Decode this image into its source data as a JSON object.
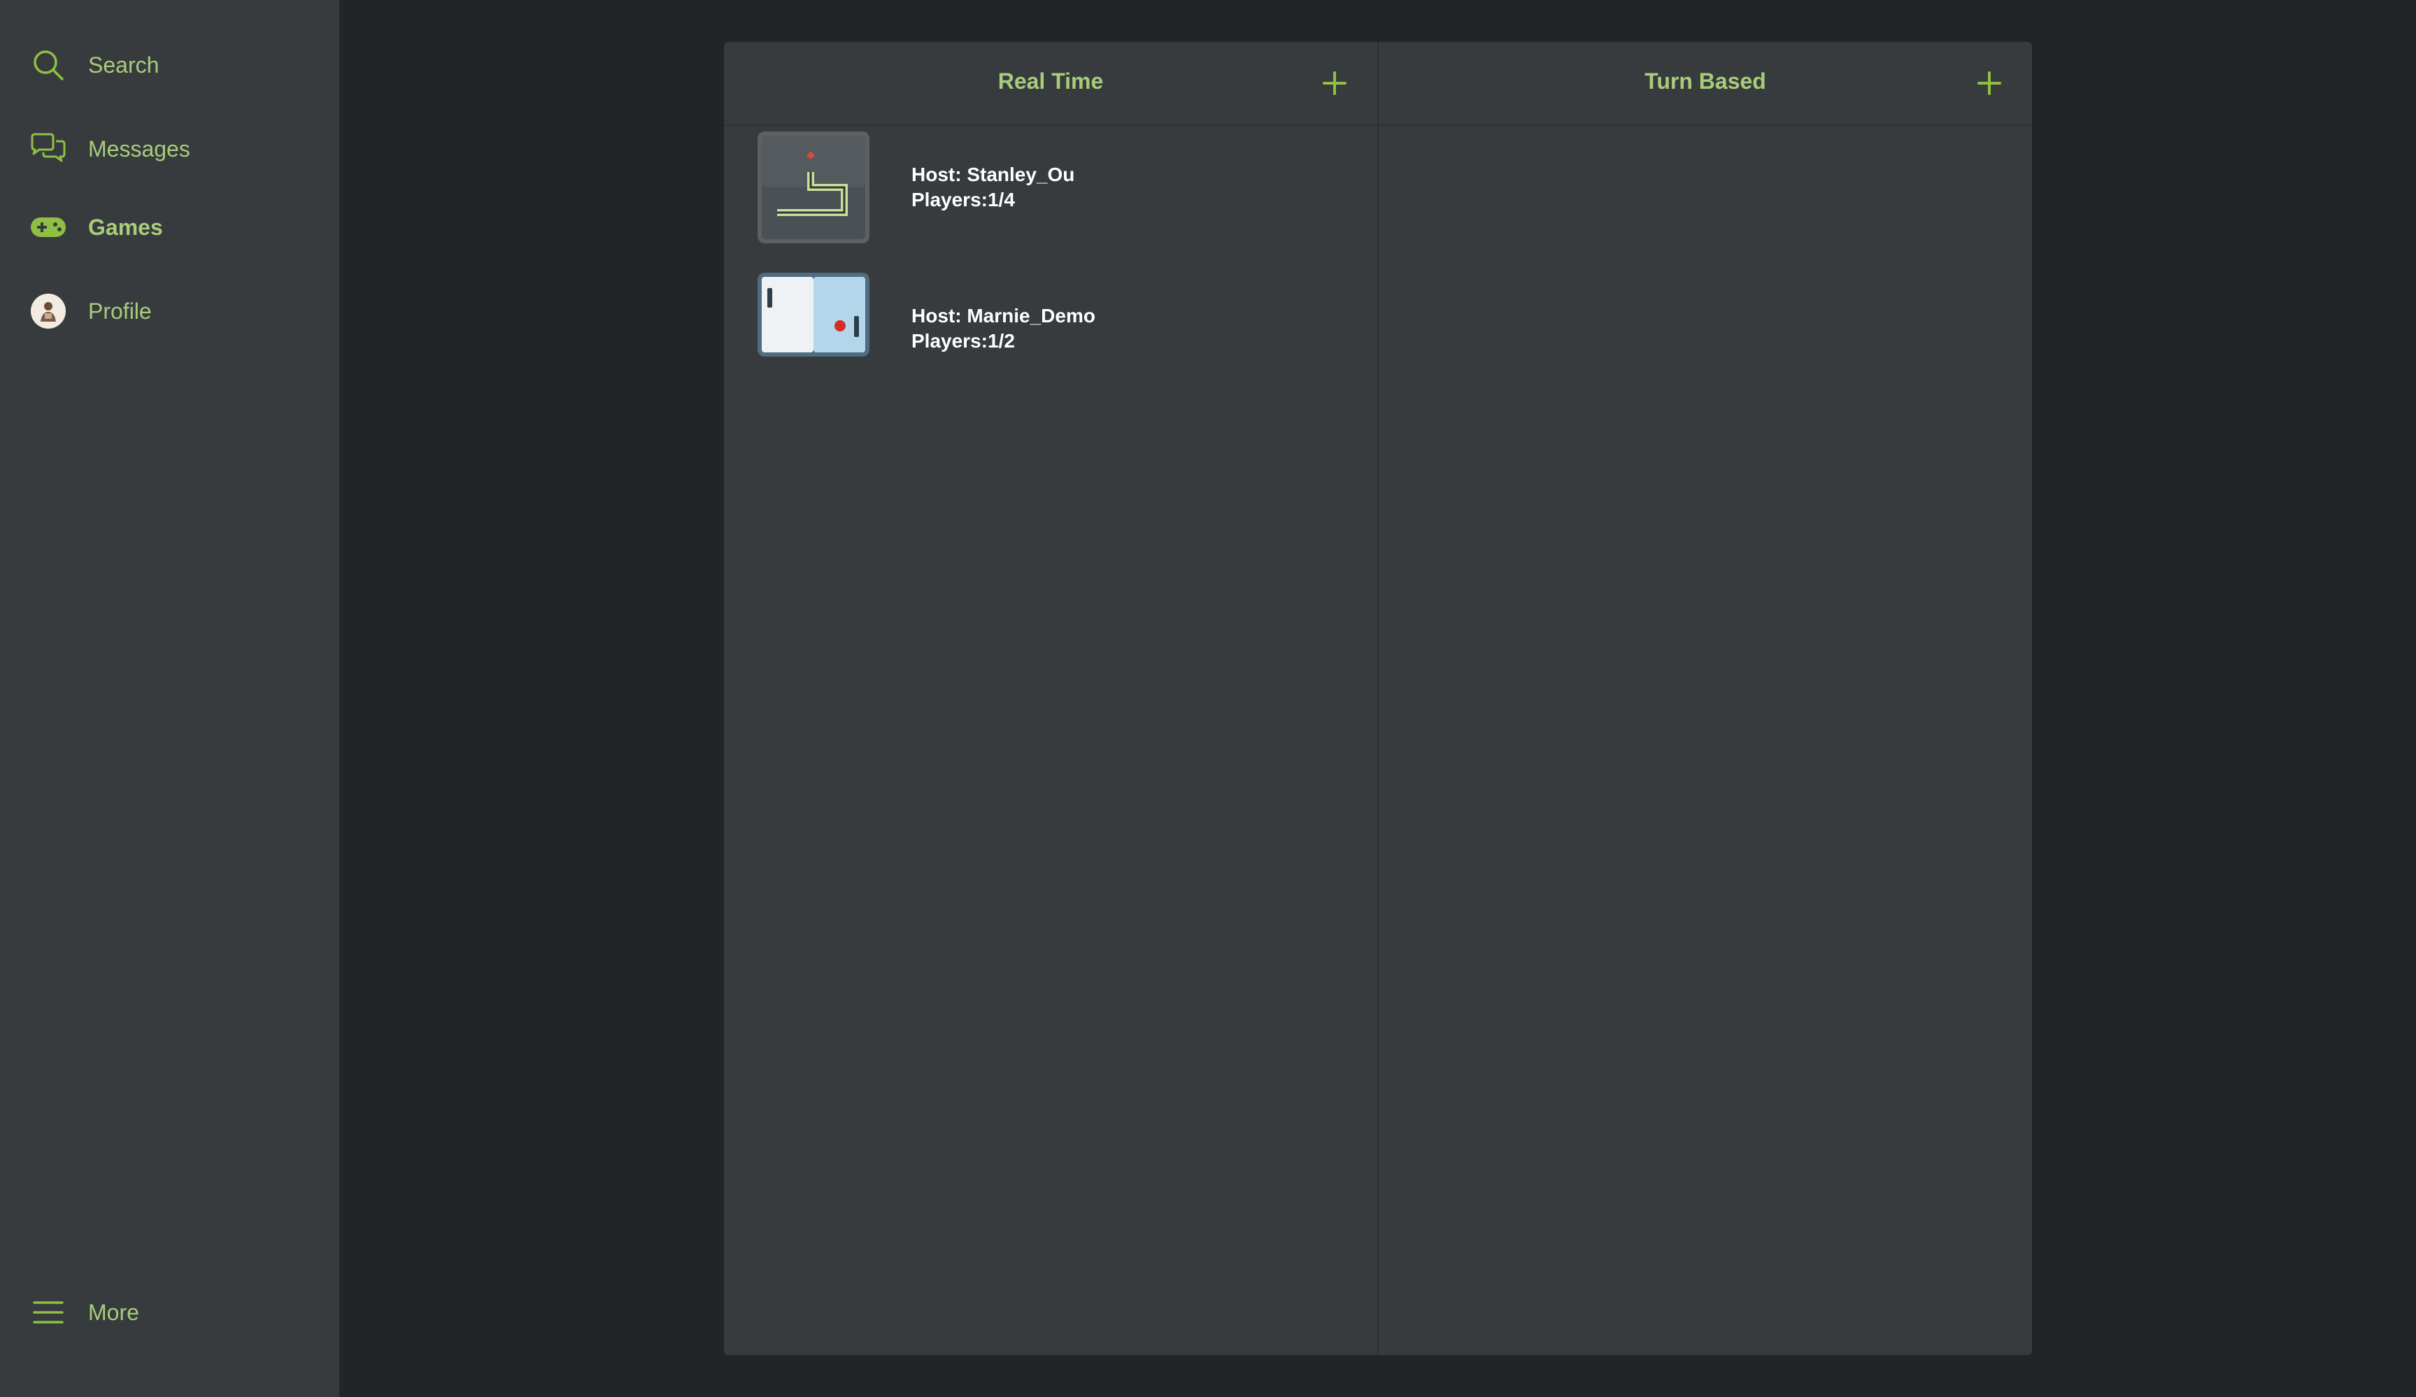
{
  "sidebar": {
    "items": [
      {
        "label": "Search",
        "icon": "search-icon"
      },
      {
        "label": "Messages",
        "icon": "messages-icon"
      },
      {
        "label": "Games",
        "icon": "gamepad-icon",
        "active": true
      },
      {
        "label": "Profile",
        "icon": "avatar"
      }
    ],
    "more": {
      "label": "More",
      "icon": "hamburger-menu-icon"
    }
  },
  "columns": [
    {
      "title": "Real Time",
      "games": [
        {
          "host": "Host: Stanley_Ou",
          "players": "Players:1/4",
          "icon": "snake-game-icon"
        },
        {
          "host": "Host: Marnie_Demo",
          "players": "Players:1/2",
          "icon": "pong-game-icon"
        }
      ]
    },
    {
      "title": "Turn Based",
      "games": []
    }
  ],
  "colors": {
    "accent": "#a8cc7a",
    "accent_strong": "#8fc043",
    "sidebar_bg": "#373b3e",
    "page_bg": "#212528",
    "panel_bg": "#373b3e"
  }
}
